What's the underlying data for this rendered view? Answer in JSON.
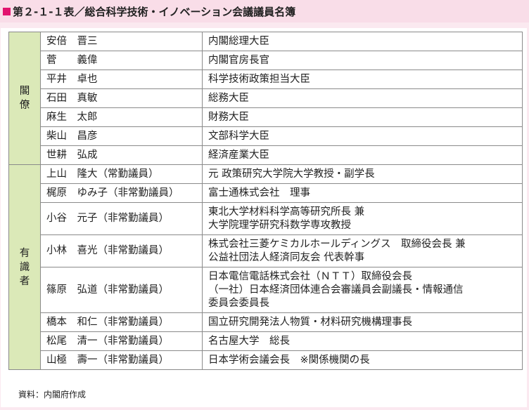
{
  "title": "第２-１-１表／総合科学技術・イノベーション会議議員名簿",
  "groups": {
    "cabinet": "閣僚",
    "experts": "有識者"
  },
  "rows": [
    {
      "name": "安倍　晋三",
      "title": "内閣総理大臣"
    },
    {
      "name": "菅　　義偉",
      "title": "内閣官房長官"
    },
    {
      "name": "平井　卓也",
      "title": "科学技術政策担当大臣"
    },
    {
      "name": "石田　真敏",
      "title": "総務大臣"
    },
    {
      "name": "麻生　太郎",
      "title": "財務大臣"
    },
    {
      "name": "柴山　昌彦",
      "title": "文部科学大臣"
    },
    {
      "name": "世耕　弘成",
      "title": "経済産業大臣"
    },
    {
      "name": "上山　隆大（常勤議員）",
      "title": "元 政策研究大学院大学教授・副学長"
    },
    {
      "name": "梶原　ゆみ子（非常勤議員）",
      "title": "富士通株式会社　理事"
    },
    {
      "name": "小谷　元子（非常勤議員）",
      "title": "東北大学材料科学高等研究所長 兼\n大学院理学研究科数学専攻教授"
    },
    {
      "name": "小林　喜光（非常勤議員）",
      "title": "株式会社三菱ケミカルホールディングス　取締役会長 兼\n公益社団法人経済同友会 代表幹事"
    },
    {
      "name": "篠原　弘道（非常勤議員）",
      "title": "日本電信電話株式会社（ＮＴＴ）取締役会長\n（一社）日本経済団体連合会審議員会副議長・情報通信\n委員会委員長"
    },
    {
      "name": "橋本　和仁（非常勤議員）",
      "title": "国立研究開発法人物質・材料研究機構理事長"
    },
    {
      "name": "松尾　清一（非常勤議員）",
      "title": "名古屋大学　総長"
    },
    {
      "name": "山極　壽一（非常勤議員）",
      "title": "日本学術会議会長　※関係機関の長"
    }
  ],
  "source": "資料：内閣府作成"
}
